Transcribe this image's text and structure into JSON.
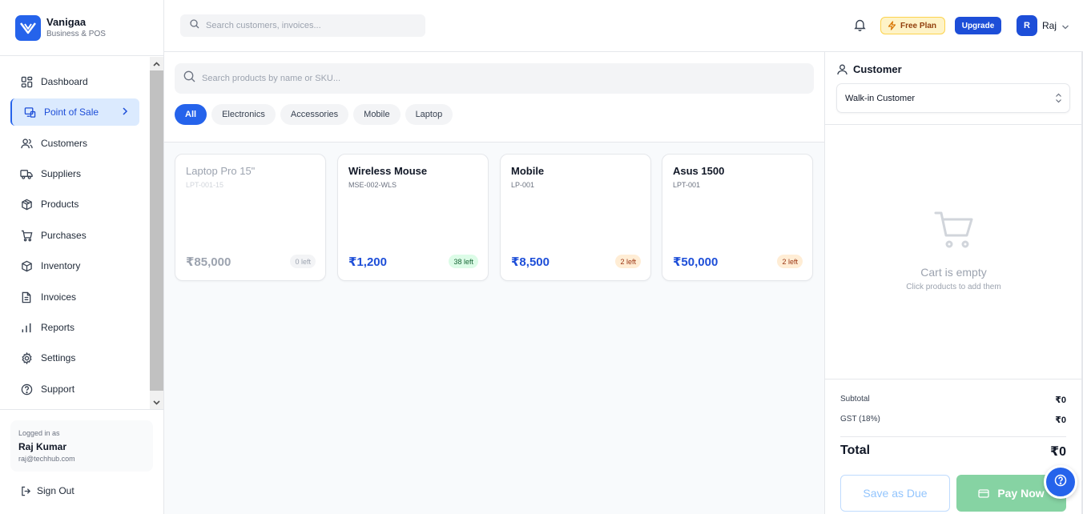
{
  "brand": {
    "name": "Vanigaa",
    "subtitle": "Business & POS"
  },
  "sidebar": {
    "items": [
      {
        "label": "Dashboard",
        "icon": "dashboard-icon"
      },
      {
        "label": "Point of Sale",
        "icon": "pos-icon",
        "active": true
      },
      {
        "label": "Customers",
        "icon": "users-icon"
      },
      {
        "label": "Suppliers",
        "icon": "truck-icon"
      },
      {
        "label": "Products",
        "icon": "package-icon"
      },
      {
        "label": "Purchases",
        "icon": "cart-icon"
      },
      {
        "label": "Inventory",
        "icon": "box-icon"
      },
      {
        "label": "Invoices",
        "icon": "file-icon"
      },
      {
        "label": "Reports",
        "icon": "bar-chart-icon"
      },
      {
        "label": "Settings",
        "icon": "gear-icon"
      },
      {
        "label": "Support",
        "icon": "help-icon"
      }
    ],
    "logged_in_label": "Logged in as",
    "user_name": "Raj Kumar",
    "user_email": "raj@techhub.com",
    "signout_label": "Sign Out"
  },
  "topbar": {
    "search_placeholder": "Search customers, invoices...",
    "plan_label": "Free Plan",
    "upgrade_label": "Upgrade",
    "avatar_initial": "R",
    "user_short": "Raj"
  },
  "pos": {
    "search_placeholder": "Search products by name or SKU...",
    "categories": [
      "All",
      "Electronics",
      "Accessories",
      "Mobile",
      "Laptop"
    ],
    "active_category": "All",
    "products": [
      {
        "name": "Laptop Pro 15\"",
        "sku": "LPT-001-15",
        "price": "₹85,000",
        "stock": "0 left",
        "stock_status": "out"
      },
      {
        "name": "Wireless Mouse",
        "sku": "MSE-002-WLS",
        "price": "₹1,200",
        "stock": "38 left",
        "stock_status": "ok"
      },
      {
        "name": "Mobile",
        "sku": "LP-001",
        "price": "₹8,500",
        "stock": "2 left",
        "stock_status": "low"
      },
      {
        "name": "Asus 1500",
        "sku": "LPT-001",
        "price": "₹50,000",
        "stock": "2 left",
        "stock_status": "low"
      }
    ]
  },
  "cart": {
    "customer_heading": "Customer",
    "customer_selected": "Walk-in Customer",
    "empty_title": "Cart is empty",
    "empty_subtitle": "Click products to add them",
    "subtotal_label": "Subtotal",
    "subtotal_value": "₹0",
    "gst_label": "GST (18%)",
    "gst_value": "₹0",
    "total_label": "Total",
    "total_value": "₹0",
    "save_due_label": "Save as Due",
    "pay_now_label": "Pay Now"
  },
  "colors": {
    "accent": "#2563eb",
    "success": "#86d3a3",
    "warning": "#fef3c7"
  }
}
